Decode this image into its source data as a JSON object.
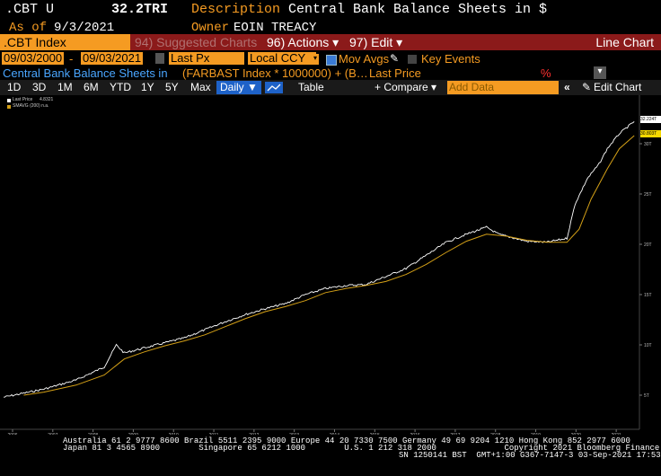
{
  "header": {
    "ticker": ".CBT U",
    "value": "32.2TRI",
    "description_label": "Description",
    "description": "Central Bank Balance Sheets in $",
    "asof_label": "As of",
    "asof": "9/3/2021",
    "owner_label": "Owner",
    "owner": "EOIN TREACY"
  },
  "toolbar": {
    "index_name": ".CBT Index",
    "suggested": "94) Suggested Charts",
    "actions": "96) Actions ▾",
    "edit": "97) Edit ▾",
    "line_chart": "Line Chart"
  },
  "controls": {
    "start_date": "09/03/2000",
    "end_date": "09/03/2021",
    "field": "Last Px",
    "currency": "Local CCY",
    "mov_avgs": "Mov Avgs",
    "key_events": "Key Events",
    "series_label": "Central Bank Balance Sheets in",
    "formula": "(FARBAST Index * 1000000) + (B…",
    "last_price": "Last Price",
    "percent": "%"
  },
  "periods": [
    "1D",
    "3D",
    "1M",
    "6M",
    "YTD",
    "1Y",
    "5Y",
    "Max"
  ],
  "period_selected": "Daily ▼",
  "table_label": "Table",
  "compare_label": "+ Compare ▾",
  "add_data_placeholder": "Add Data",
  "edit_chart": "Edit Chart",
  "legend": {
    "last_price": "Last Price",
    "last_price_val": "4.8321",
    "smavg": "SMAVG (200)  n.a."
  },
  "axis_tags": {
    "last": "32.224T",
    "avg": "30.803T"
  },
  "footer": {
    "line1": "Australia 61 2 9777 8600 Brazil 5511 2395 9000 Europe 44 20 7330 7500 Germany 49 69 9204 1210 Hong Kong 852 2977 6000",
    "line2": "Japan 81 3 4565 8900        Singapore 65 6212 1000        U.S. 1 212 318 2000              Copyright 2021 Bloomberg Finance L.P.",
    "line3": "SN 1250141 BST  GMT+1:00 G367-7147-3 03-Sep-2021 17:53:02"
  },
  "chart_data": {
    "type": "line",
    "x_labels": [
      "2006",
      "2007",
      "2008",
      "2009",
      "2010",
      "2011",
      "2012",
      "2013",
      "2014",
      "2015",
      "2016",
      "2017",
      "2018",
      "2019",
      "2020",
      "2021"
    ],
    "y_ticks": [
      "5T",
      "10T",
      "15T",
      "20T",
      "25T",
      "30T"
    ],
    "ylim": [
      3,
      35
    ],
    "series": [
      {
        "name": "Last Price",
        "color": "#ffffff",
        "x": [
          2006.0,
          2007.0,
          2007.8,
          2008.5,
          2008.8,
          2009.0,
          2009.5,
          2010.0,
          2010.5,
          2011.0,
          2011.5,
          2012.0,
          2012.5,
          2013.0,
          2013.5,
          2014.0,
          2014.5,
          2015.0,
          2015.5,
          2016.0,
          2016.5,
          2017.0,
          2017.5,
          2018.0,
          2018.3,
          2018.6,
          2019.0,
          2019.5,
          2020.0,
          2020.2,
          2020.5,
          2020.8,
          2021.0,
          2021.3,
          2021.67
        ],
        "y": [
          4.8,
          5.6,
          6.5,
          7.8,
          10.0,
          9.2,
          9.7,
          10.2,
          10.7,
          11.5,
          12.3,
          13.0,
          13.6,
          14.1,
          15.0,
          15.6,
          15.9,
          16.0,
          16.8,
          17.6,
          18.9,
          20.2,
          21.0,
          21.7,
          21.0,
          20.7,
          20.3,
          20.2,
          20.6,
          24.0,
          26.5,
          28.0,
          29.5,
          31.0,
          32.2
        ]
      },
      {
        "name": "SMAVG (200)",
        "color": "#d4a017",
        "x": [
          2006.5,
          2007.0,
          2007.8,
          2008.5,
          2009.0,
          2009.5,
          2010.0,
          2010.5,
          2011.0,
          2011.5,
          2012.0,
          2012.5,
          2013.0,
          2013.5,
          2014.0,
          2014.5,
          2015.0,
          2015.5,
          2016.0,
          2016.5,
          2017.0,
          2017.5,
          2018.0,
          2018.5,
          2019.0,
          2019.5,
          2020.0,
          2020.3,
          2020.6,
          2021.0,
          2021.3,
          2021.67
        ],
        "y": [
          5.0,
          5.3,
          6.0,
          7.0,
          8.6,
          9.3,
          9.9,
          10.4,
          11.0,
          11.8,
          12.6,
          13.3,
          13.8,
          14.4,
          15.2,
          15.6,
          15.9,
          16.3,
          17.0,
          18.0,
          19.2,
          20.3,
          21.0,
          20.8,
          20.4,
          20.2,
          20.2,
          21.5,
          24.5,
          27.5,
          29.5,
          30.8
        ]
      }
    ]
  }
}
